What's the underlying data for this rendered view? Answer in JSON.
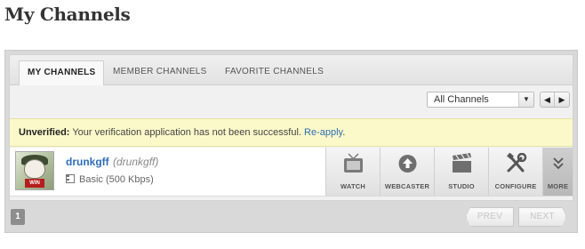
{
  "page": {
    "title": "My Channels"
  },
  "tabs": [
    {
      "label": "MY CHANNELS",
      "active": true
    },
    {
      "label": "MEMBER CHANNELS",
      "active": false
    },
    {
      "label": "FAVORITE CHANNELS",
      "active": false
    }
  ],
  "filter": {
    "selected": "All Channels",
    "arrow_icon": "caret-down-icon"
  },
  "notice": {
    "label": "Unverified:",
    "message": "Your verification application has not been successful.",
    "link": "Re-apply",
    "end": "."
  },
  "channel": {
    "name": "drunkgff",
    "handle": "(drunkgff)",
    "plan": "Basic (500 Kbps)",
    "avatar_badge": "WIN"
  },
  "actions": [
    {
      "label": "WATCH",
      "icon": "tv-icon"
    },
    {
      "label": "WEBCASTER",
      "icon": "upload-icon"
    },
    {
      "label": "STUDIO",
      "icon": "clapperboard-icon"
    },
    {
      "label": "CONFIGURE",
      "icon": "tools-icon"
    },
    {
      "label": "MORE",
      "icon": "double-chevron-down-icon"
    }
  ],
  "pagination": {
    "current": "1",
    "prev": "PREV",
    "next": "NEXT"
  },
  "colors": {
    "link": "#2f6db5",
    "notice_bg": "#fbf9c9"
  }
}
